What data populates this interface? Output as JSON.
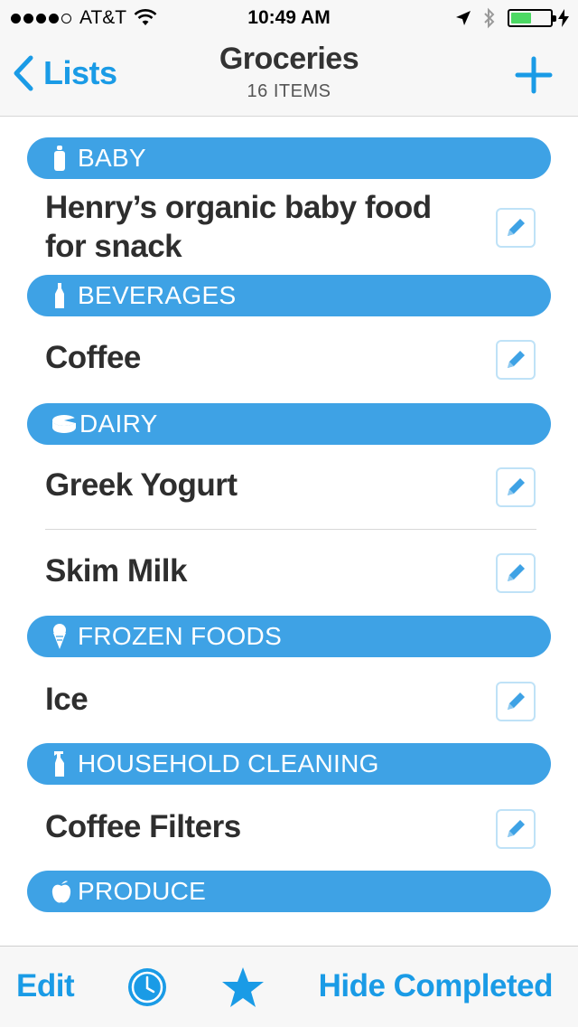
{
  "status_bar": {
    "carrier": "AT&T",
    "time": "10:49 AM",
    "battery_level": 0.52
  },
  "nav": {
    "back_label": "Lists",
    "title": "Groceries",
    "subtitle": "16 ITEMS"
  },
  "list": {
    "categories": [
      {
        "label": "BABY",
        "icon": "baby-bottle-icon"
      },
      {
        "label": "BEVERAGES",
        "icon": "bottle-icon"
      },
      {
        "label": "DAIRY",
        "icon": "cheese-icon"
      },
      {
        "label": "FROZEN FOODS",
        "icon": "ice-cream-icon"
      },
      {
        "label": "HOUSEHOLD CLEANING",
        "icon": "spray-bottle-icon"
      },
      {
        "label": "PRODUCE",
        "icon": "apple-icon"
      }
    ],
    "items": [
      {
        "text": "Henry’s organic baby food for snack",
        "category": "BABY"
      },
      {
        "text": "Coffee",
        "category": "BEVERAGES"
      },
      {
        "text": "Greek Yogurt",
        "category": "DAIRY"
      },
      {
        "text": "Skim Milk",
        "category": "DAIRY"
      },
      {
        "text": "Ice",
        "category": "FROZEN FOODS"
      },
      {
        "text": "Coffee Filters",
        "category": "HOUSEHOLD CLEANING"
      }
    ]
  },
  "tab_bar": {
    "edit_label": "Edit",
    "hide_completed_label": "Hide Completed"
  },
  "colors": {
    "accent": "#1a9be6",
    "category_bg": "#3ea2e5",
    "edit_border": "#bfe2f7"
  }
}
